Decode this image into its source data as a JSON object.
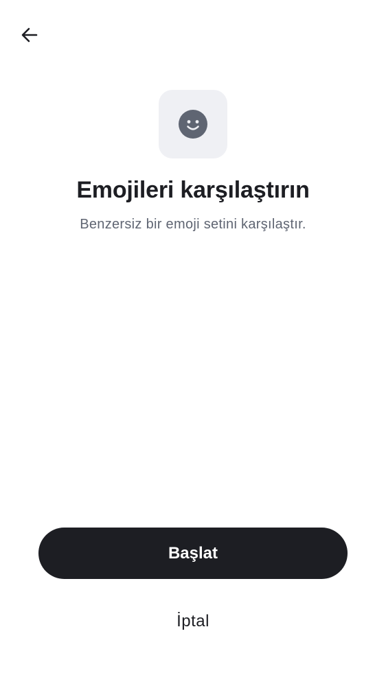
{
  "header": {
    "back_icon": "arrow-left-icon"
  },
  "hero": {
    "icon": "smiley-face-icon",
    "title": "Emojileri karşılaştırın",
    "subtitle": "Benzersiz bir emoji setini karşılaştır."
  },
  "actions": {
    "start_label": "Başlat",
    "cancel_label": "İptal"
  },
  "colors": {
    "primary": "#1d1e23",
    "icon_tile_bg": "#eff0f4",
    "icon_fg": "#5f6572",
    "subtitle": "#5f6572"
  }
}
